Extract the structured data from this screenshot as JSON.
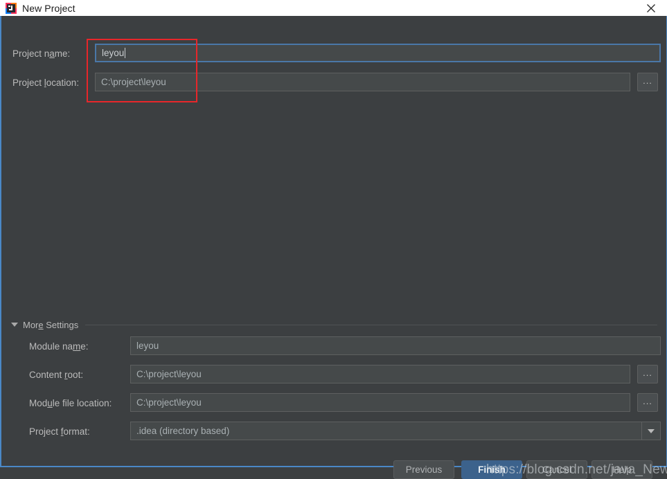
{
  "window": {
    "title": "New Project",
    "app_icon": "intellij-idea-icon",
    "close_icon": "close-icon",
    "border_color": "#4a88c7",
    "background": "#3c3f41"
  },
  "main": {
    "project_name": {
      "label_before": "Project n",
      "label_mnemonic": "a",
      "label_after": "me:",
      "value": "leyou",
      "focused": true
    },
    "project_location": {
      "label_before": "Project ",
      "label_mnemonic": "l",
      "label_after": "ocation:",
      "value": "C:\\project\\leyou",
      "browse_label": "..."
    }
  },
  "annotation": {
    "type": "red-rectangle-highlight",
    "color": "#e8262a"
  },
  "more_settings": {
    "label_before": "Mor",
    "label_mnemonic": "e",
    "label_after": " Settings",
    "expanded": true,
    "arrow_icon": "triangle-down-icon",
    "fields": {
      "module_name": {
        "label_before": "Module na",
        "label_mnemonic": "m",
        "label_after": "e:",
        "value": "leyou"
      },
      "content_root": {
        "label_before": "Content ",
        "label_mnemonic": "r",
        "label_after": "oot:",
        "value": "C:\\project\\leyou",
        "browse_label": "..."
      },
      "module_file_location": {
        "label_before": "Mod",
        "label_mnemonic": "u",
        "label_after": "le file location:",
        "value": "C:\\project\\leyou",
        "browse_label": "..."
      },
      "project_format": {
        "label_before": "Project ",
        "label_mnemonic": "f",
        "label_after": "ormat:",
        "value": ".idea (directory based)",
        "arrow_icon": "chevron-down-icon"
      }
    }
  },
  "footer": {
    "previous_label": "Previous",
    "finish_label": "Finish",
    "cancel_label": "Cancel",
    "help_label": "Help",
    "primary_color": "#3c628c"
  },
  "watermark": {
    "text": "https://blog.csdn.net/java_New_"
  }
}
